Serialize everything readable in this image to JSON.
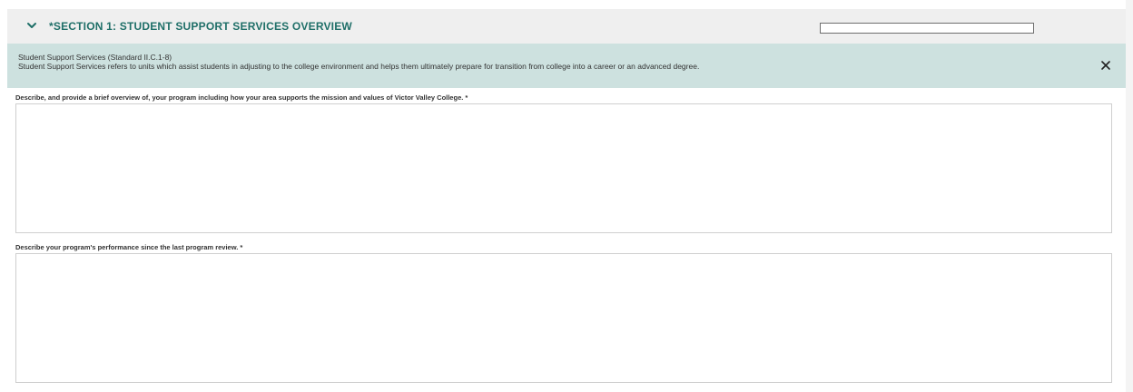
{
  "section": {
    "title": "*SECTION 1: STUDENT SUPPORT SERVICES OVERVIEW",
    "chevron_icon": "chevron-down-icon",
    "header_field_value": "",
    "accent_color": "#1f6f68"
  },
  "banner": {
    "heading": "Student Support Services (Standard II.C.1-8)",
    "description": "Student Support Services refers to units which assist students in adjusting to the college environment and helps them ultimately prepare for transition from college into a career or an advanced degree.",
    "close_icon": "close-icon",
    "background_color": "#cde1df"
  },
  "questions": [
    {
      "label": "Describe, and provide a brief overview of, your program including how your area supports the mission and values of Victor Valley College.  *",
      "value": ""
    },
    {
      "label": "Describe your program's performance since the last program review. *",
      "value": ""
    }
  ]
}
